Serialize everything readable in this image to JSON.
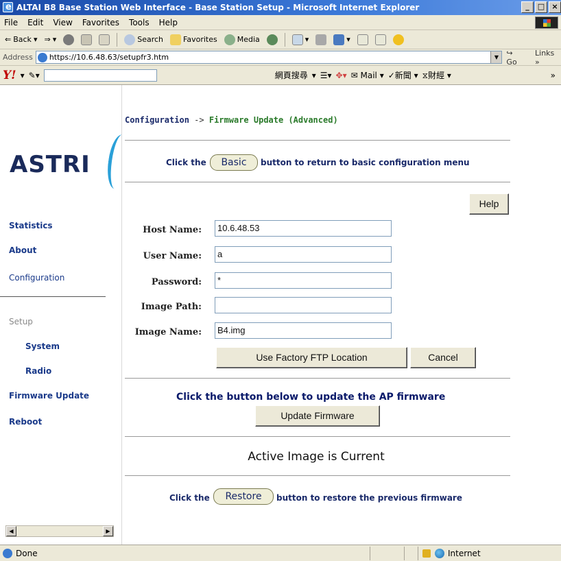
{
  "window": {
    "title": "ALTAI B8 Base Station Web Interface - Base Station Setup - Microsoft Internet Explorer",
    "min": "_",
    "max": "□",
    "close": "×"
  },
  "menu": [
    "File",
    "Edit",
    "View",
    "Favorites",
    "Tools",
    "Help"
  ],
  "toolbar": {
    "back": "Back",
    "search": "Search",
    "favorites": "Favorites",
    "media": "Media"
  },
  "address": {
    "label": "Address",
    "url": "https://10.6.48.63/setupfr3.htm",
    "go": "Go",
    "links": "Links"
  },
  "yahoo": {
    "logo": "Y!",
    "search_btn": "網頁搜尋",
    "mail": "Mail",
    "news": "新聞",
    "finance": "財經"
  },
  "sidebar": {
    "logo_text": "ASTRI",
    "items": [
      {
        "label": "Statistics"
      },
      {
        "label": "About"
      },
      {
        "label": "Configuration"
      },
      {
        "label": "Setup"
      },
      {
        "label": "System"
      },
      {
        "label": "Radio"
      },
      {
        "label": "Firmware Update"
      },
      {
        "label": "Reboot"
      }
    ]
  },
  "breadcrumb": {
    "section": "Configuration",
    "arrow": "->",
    "current": "Firmware Update (Advanced)"
  },
  "basic_line": {
    "prefix": "Click the",
    "button": "Basic",
    "suffix": "button to return to basic configuration menu"
  },
  "help_label": "Help",
  "form": {
    "host_label": "Host Name:",
    "host_value": "10.6.48.53",
    "user_label": "User Name:",
    "user_value": "a",
    "password_label": "Password:",
    "password_value": "*",
    "path_label": "Image Path:",
    "path_value": "",
    "name_label": "Image Name:",
    "name_value": "B4.img",
    "factory_btn": "Use Factory FTP Location",
    "cancel_btn": "Cancel"
  },
  "update": {
    "prompt": "Click the button below to update the AP firmware",
    "button": "Update Firmware"
  },
  "active_status": "Active Image is Current",
  "restore_line": {
    "prefix": "Click the",
    "button": "Restore",
    "suffix": "button to restore the previous firmware"
  },
  "statusbar": {
    "done": "Done",
    "zone": "Internet"
  }
}
